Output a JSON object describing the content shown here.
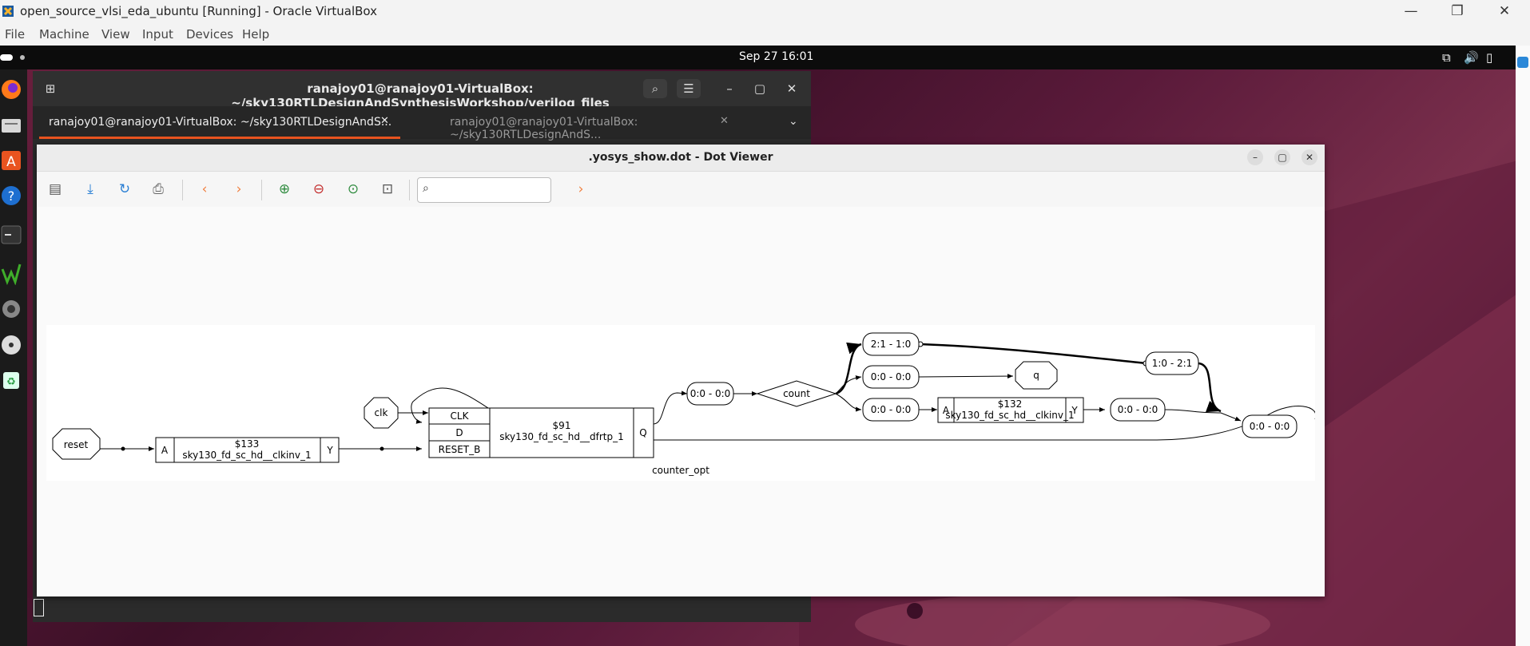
{
  "vbox": {
    "title": "open_source_vlsi_eda_ubuntu [Running] - Oracle VirtualBox",
    "menu": [
      "File",
      "Machine",
      "View",
      "Input",
      "Devices",
      "Help"
    ]
  },
  "guest": {
    "clock": "Sep 27  16:01"
  },
  "terminal": {
    "title": "ranajoy01@ranajoy01-VirtualBox: ~/sky130RTLDesignAndSynthesisWorkshop/verilog_files",
    "tab1": "ranajoy01@ranajoy01-VirtualBox: ~/sky130RTLDesignAndS...",
    "tab2": "ranajoy01@ranajoy01-VirtualBox: ~/sky130RTLDesignAndS..."
  },
  "dotviewer": {
    "title": ".yosys_show.dot - Dot Viewer",
    "search_placeholder": ""
  },
  "graph": {
    "module_label": "counter_opt",
    "ports": {
      "reset": "reset",
      "clk": "clk",
      "q": "q"
    },
    "inv1": {
      "id": "$133",
      "cell": "sky130_fd_sc_hd__clkinv_1",
      "in": "A",
      "out": "Y"
    },
    "dff": {
      "id": "$91",
      "cell": "sky130_fd_sc_hd__dfrtp_1",
      "clk": "CLK",
      "d": "D",
      "rst": "RESET_B",
      "q": "Q"
    },
    "inv2": {
      "id": "$132",
      "cell": "sky130_fd_sc_hd__clkinv_1",
      "in": "A",
      "out": "Y"
    },
    "count": "count",
    "slices": {
      "s1": "0:0 - 0:0",
      "s_top": "2:1 - 1:0",
      "s_mid": "0:0 - 0:0",
      "s_low": "0:0 - 0:0",
      "s_right": "1:0 - 2:1",
      "s_inv_out": "0:0 - 0:0",
      "s_far": "0:0 - 0:0"
    }
  }
}
